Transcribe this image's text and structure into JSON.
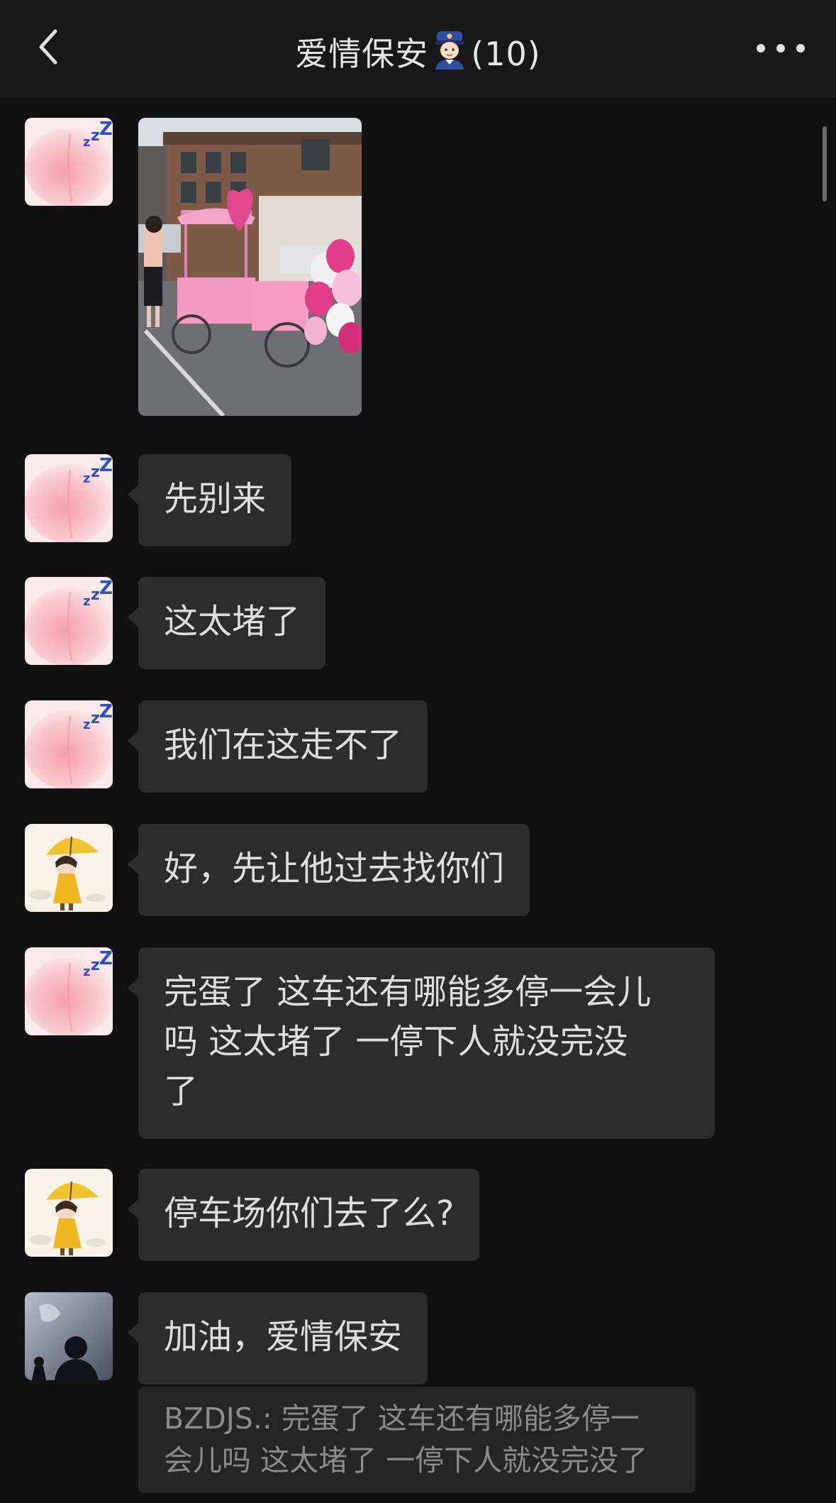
{
  "header": {
    "back_icon": "chevron-left-icon",
    "title": "爱情保安",
    "title_emoji": "police-officer-emoji",
    "member_count": "(10)",
    "more_icon": "more-dots-icon"
  },
  "messages": [
    {
      "sender_avatar": "peach-avatar",
      "type": "image",
      "image_desc": "pink-cart-photo"
    },
    {
      "sender_avatar": "peach-avatar",
      "type": "text",
      "text": "先别来"
    },
    {
      "sender_avatar": "peach-avatar",
      "type": "text",
      "text": "这太堵了"
    },
    {
      "sender_avatar": "peach-avatar",
      "type": "text",
      "text": "我们在这走不了"
    },
    {
      "sender_avatar": "umbrella-girl-avatar",
      "type": "text",
      "text": "好，先让他过去找你们"
    },
    {
      "sender_avatar": "peach-avatar",
      "type": "text",
      "lines": [
        "完蛋了 这车还有哪能多停一会儿",
        "吗 这太堵了 一停下人就没完没",
        "了"
      ]
    },
    {
      "sender_avatar": "umbrella-girl-avatar",
      "type": "text",
      "text": "停车场你们去了么?"
    },
    {
      "sender_avatar": "silhouette-avatar",
      "type": "text",
      "text": "加油，爱情保安"
    }
  ],
  "quote": {
    "lines": [
      "BZDJS.: 完蛋了 这车还有哪能多停一",
      "会儿吗 这太堵了 一停下人就没完没了"
    ]
  },
  "colors": {
    "background": "#111111",
    "header": "#181818",
    "bubble": "#2c2c2c",
    "quote": "#252525"
  }
}
